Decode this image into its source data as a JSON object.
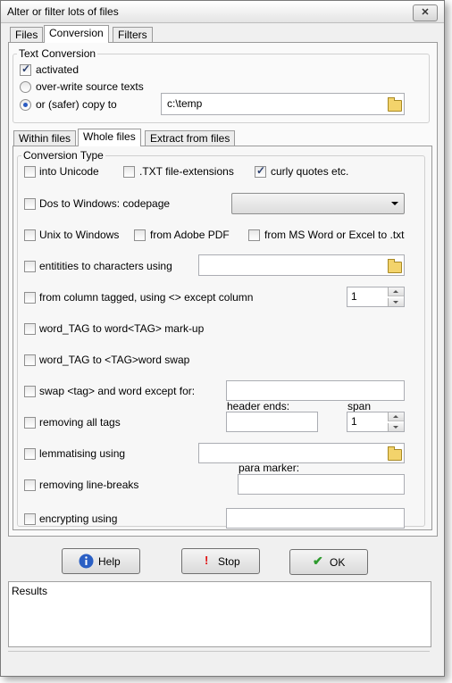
{
  "window": {
    "title": "Alter or filter lots of files"
  },
  "top_tabs": [
    "Files",
    "Conversion",
    "Filters"
  ],
  "text_conversion": {
    "legend": "Text Conversion",
    "activated_label": "activated",
    "overwrite_label": "over-write source texts",
    "copy_label": "or (safer) copy to",
    "copy_path": "c:\\temp"
  },
  "sub_tabs": [
    "Within files",
    "Whole files",
    "Extract from files"
  ],
  "conversion_type": {
    "legend": "Conversion Type",
    "into_unicode": "into Unicode",
    "txt_extensions": ".TXT file-extensions",
    "curly_quotes": "curly quotes etc.",
    "dos_to_windows": "Dos to Windows: codepage",
    "unix_to_windows": "Unix to Windows",
    "from_adobe_pdf": "from Adobe PDF",
    "from_ms_word": "from MS Word or Excel to .txt",
    "entities": "entitities to characters using",
    "column_tagged": "from column tagged, using <> except column",
    "column_value": "1",
    "word_tag_markup": "word_TAG to word<TAG> mark-up",
    "word_tag_swap": "word_TAG to <TAG>word swap",
    "swap_tag": "swap <tag> and word except for:",
    "header_ends": "header ends:",
    "span_label": "span",
    "removing_tags": "removing all tags",
    "span_value": "1",
    "lemmatising": "lemmatising using",
    "para_marker": "para marker:",
    "removing_linebreaks": "removing line-breaks",
    "encrypting": "encrypting using"
  },
  "buttons": {
    "help": "Help",
    "stop": "Stop",
    "ok": "OK"
  },
  "results": {
    "label": "Results"
  },
  "colors": {
    "help_icon": "#2a5fc4",
    "stop_icon": "#e01010",
    "ok_icon": "#2e9b2e"
  }
}
